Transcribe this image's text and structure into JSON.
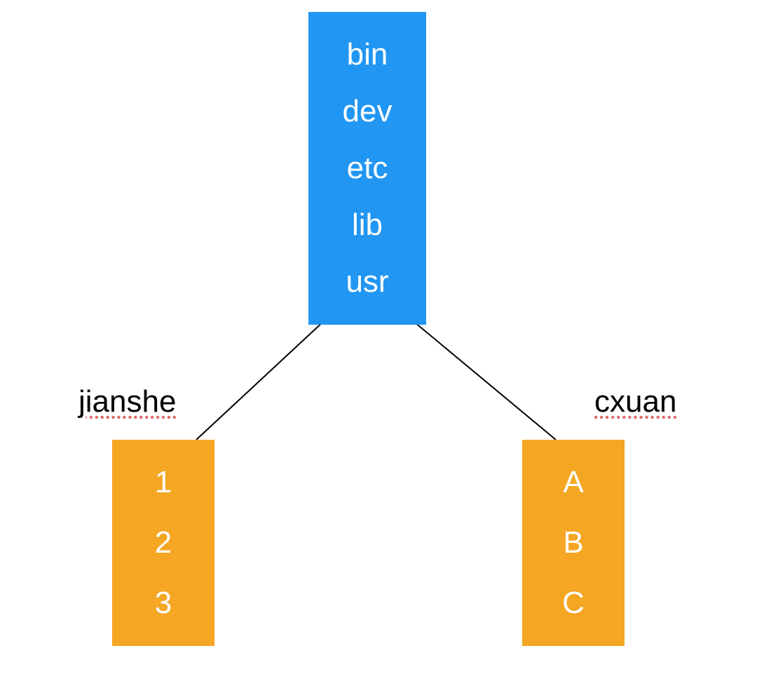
{
  "diagram": {
    "root": {
      "items": [
        "bin",
        "dev",
        "etc",
        "lib",
        "usr"
      ]
    },
    "left": {
      "label": "jianshe",
      "items": [
        "1",
        "2",
        "3"
      ]
    },
    "right": {
      "label": "cxuan",
      "items": [
        "A",
        "B",
        "C"
      ]
    }
  },
  "colors": {
    "root_bg": "#2196f3",
    "child_bg": "#f5a623",
    "text": "#ffffff",
    "label": "#000000"
  }
}
